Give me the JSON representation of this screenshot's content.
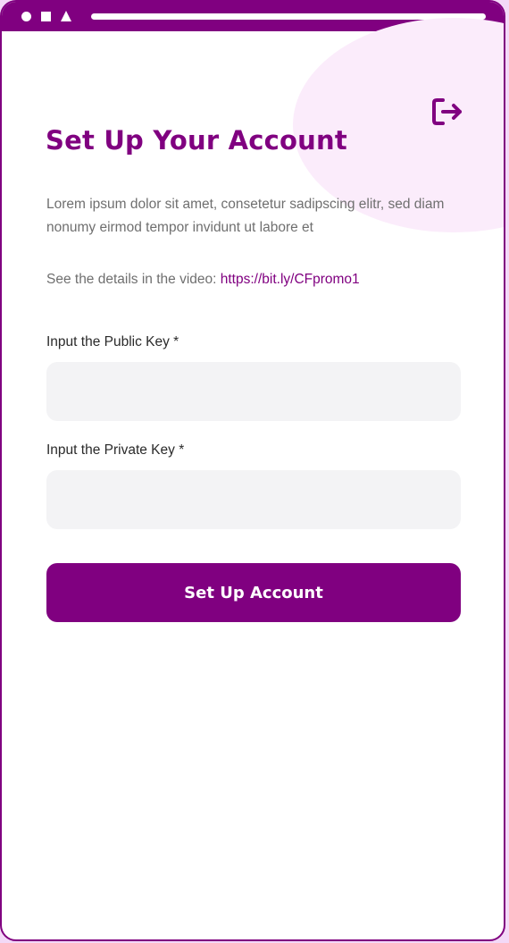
{
  "window": {
    "controls": [
      "circle",
      "square",
      "triangle"
    ]
  },
  "header": {
    "logout_icon": "logout-icon"
  },
  "page": {
    "title": "Set Up Your Account",
    "intro": "Lorem ipsum dolor sit amet, consetetur sadipscing elitr, sed diam nonumy eirmod tempor invidunt ut labore et",
    "video_prefix": "See the details in the video: ",
    "video_link": "https://bit.ly/CFpromo1"
  },
  "form": {
    "public_key": {
      "label": "Input the Public Key *",
      "value": "",
      "placeholder": ""
    },
    "private_key": {
      "label": "Input the Private Key *",
      "value": "",
      "placeholder": ""
    },
    "submit_label": "Set Up Account"
  },
  "colors": {
    "brand": "#800080",
    "field_background": "#f3f3f5",
    "accent_blob": "#fbecfb",
    "body_text": "#6f6f6f"
  }
}
